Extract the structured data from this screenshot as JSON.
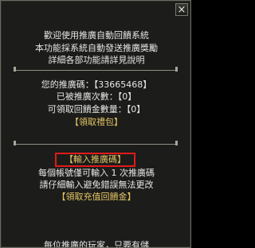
{
  "window": {
    "close_glyph": "×"
  },
  "intro": {
    "line1": "歡迎使用推廣自動回饋系統",
    "line2": "本功能採系統自動發送推廣獎勵",
    "line3": "詳細各部功能請詳見說明"
  },
  "stats": {
    "code_label": "您的推廣碼：【33665468】",
    "count_label": "已被推廣次數：【0】",
    "gold_label": "可領取回饋金數量：【0】",
    "claim_gift": "【領取禮包】"
  },
  "promo": {
    "input_button": "【輸入推廣碼】",
    "note1": "每個帳號僅可輸入 1 次推廣碼",
    "note2": "請仔細輸入避免錯誤無法更改",
    "claim_recharge": "【領取充值回饋金】",
    "footer_partial": "每位推廣的玩家，只要有儲"
  },
  "colors": {
    "text": "#e6e6e6",
    "highlight": "#e3c465",
    "focus_border": "#e11a1a"
  }
}
